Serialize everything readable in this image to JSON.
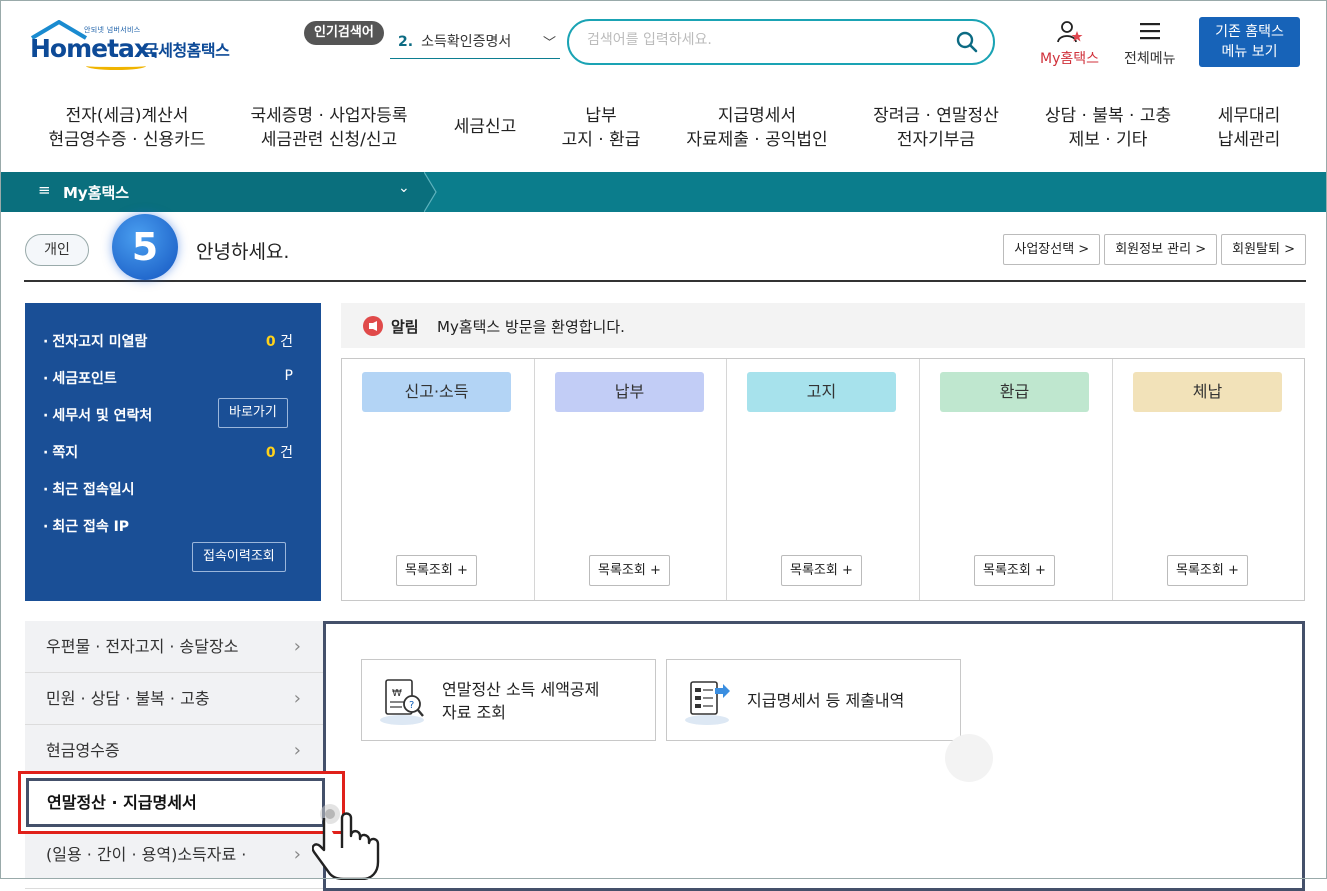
{
  "logo": {
    "small": "안되넷 넘버서비스",
    "brand": "Hometax.",
    "kor": "국세청홈택스"
  },
  "popular": {
    "badge": "인기검색어",
    "rank": "2.",
    "term": "소득확인증명서"
  },
  "search": {
    "placeholder": "검색어를 입력하세요."
  },
  "tools": {
    "my": "My홈택스",
    "all": "전체메뉴"
  },
  "classic": {
    "line1": "기존 홈택스",
    "line2": "메뉴 보기"
  },
  "gnb": [
    {
      "l1": "전자(세금)계산서",
      "l2": "현금영수증 · 신용카드"
    },
    {
      "l1": "국세증명 · 사업자등록",
      "l2": "세금관련 신청/신고"
    },
    {
      "l1": "세금신고",
      "l2": ""
    },
    {
      "l1": "납부",
      "l2": "고지 · 환급"
    },
    {
      "l1": "지급명세서",
      "l2": "자료제출 · 공익법인"
    },
    {
      "l1": "장려금 · 연말정산",
      "l2": "전자기부금"
    },
    {
      "l1": "상담 · 불복 · 고충",
      "l2": "제보 · 기타"
    },
    {
      "l1": "세무대리",
      "l2": "납세관리"
    }
  ],
  "lnb": {
    "menu": "My홈택스"
  },
  "greeting": {
    "type": "개인",
    "step": "5",
    "hello": "안녕하세요.",
    "btn1": "사업장선택 >",
    "btn2": "회원정보 관리 >",
    "btn3": "회원탈퇴 >"
  },
  "info": {
    "r1": "전자고지 미열람",
    "r1v": "0",
    "r1u": " 건",
    "r2": "세금포인트",
    "r2v": "P",
    "r3": "세무서 및 연락처",
    "r3b": "바로가기",
    "r4": "쪽지",
    "r4v": "0",
    "r4u": " 건",
    "r5": "최근 접속일시",
    "r6": "최근 접속 IP",
    "r6b": "접속이력조회"
  },
  "notice": {
    "label": "알림",
    "text": "My홈택스 방문을 환영합니다."
  },
  "categories": [
    {
      "label": "신고·소득",
      "color": "#b3d4f5",
      "more": "목록조회 +"
    },
    {
      "label": "납부",
      "color": "#c2cdf6",
      "more": "목록조회 +"
    },
    {
      "label": "고지",
      "color": "#a7e2ec",
      "more": "목록조회 +"
    },
    {
      "label": "환급",
      "color": "#bfe7cf",
      "more": "목록조회 +"
    },
    {
      "label": "체납",
      "color": "#f2e2b9",
      "more": "목록조회 +"
    }
  ],
  "leftmenu": [
    {
      "label": "우편물 · 전자고지 · 송달장소"
    },
    {
      "label": "민원 · 상담 · 불복 · 고충"
    },
    {
      "label": "현금영수증"
    },
    {
      "label": "연말정산 · 지급명세서"
    },
    {
      "label": "(일용 · 간이 · 용역)소득자료 ·"
    }
  ],
  "cards": [
    {
      "l1": "연말정산 소득 세액공제",
      "l2": "자료 조회"
    },
    {
      "l1": "지급명세서 등 제출내역",
      "l2": ""
    }
  ]
}
